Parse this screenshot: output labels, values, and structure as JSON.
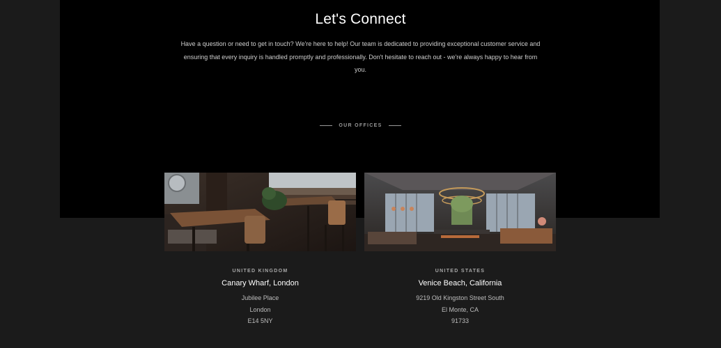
{
  "contact": {
    "title": "Let's Connect",
    "intro": "Have a question or need to get in touch? We're here to help! Our team is dedicated to providing exceptional customer service and ensuring that every inquiry is handled promptly and professionally. Don't hesitate to reach out - we're always happy to hear from you."
  },
  "offices": {
    "heading": "OUR OFFICES",
    "items": [
      {
        "country": "UNITED KINGDOM",
        "city": "Canary Wharf, London",
        "address": [
          "Jubilee Place",
          "London",
          "E14 5NY"
        ]
      },
      {
        "country": "UNITED STATES",
        "city": "Venice Beach, California",
        "address": [
          "9219 Old Kingston Street South",
          "El Monte, CA",
          "91733"
        ]
      }
    ]
  },
  "colors": {
    "page_background": "#1b1b1b",
    "hero_background": "#000000",
    "text_primary": "#ffffff",
    "text_muted": "#a8a8a8"
  }
}
